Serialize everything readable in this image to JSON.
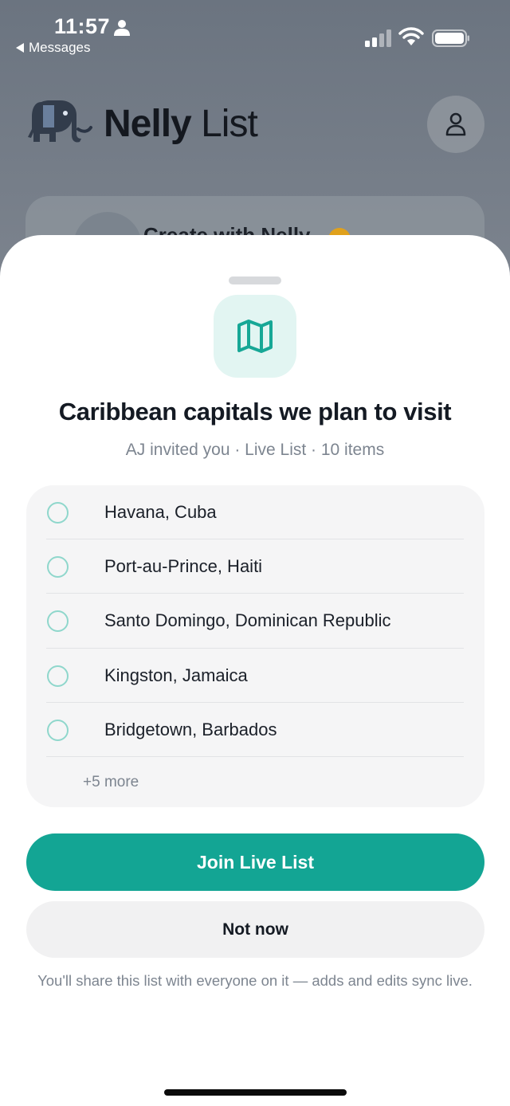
{
  "status_bar": {
    "time": "11:57",
    "back_label": "Messages"
  },
  "background_app": {
    "brand_bold": "Nelly",
    "brand_light": "List",
    "card_title": "Create with Nelly"
  },
  "sheet": {
    "title": "Caribbean capitals we plan to visit",
    "subtitle": "AJ invited you · Live List · 10 items",
    "items": [
      {
        "label": "Havana, Cuba"
      },
      {
        "label": "Port-au-Prince, Haiti"
      },
      {
        "label": "Santo Domingo, Dominican Republic"
      },
      {
        "label": "Kingston, Jamaica"
      },
      {
        "label": "Bridgetown, Barbados"
      }
    ],
    "more_label": "+5 more",
    "join_label": "Join Live List",
    "not_now_label": "Not now",
    "footnote": "You'll share this list with everyone on it — adds and edits sync live."
  },
  "colors": {
    "accent": "#13a594",
    "check_ring": "#8fd7cc",
    "icon_bg": "#e2f5f2"
  },
  "icons": [
    "person-icon",
    "signal-icon",
    "wifi-icon",
    "battery-icon",
    "elephant-logo-icon",
    "profile-icon",
    "map-icon",
    "circle-check-icon"
  ]
}
